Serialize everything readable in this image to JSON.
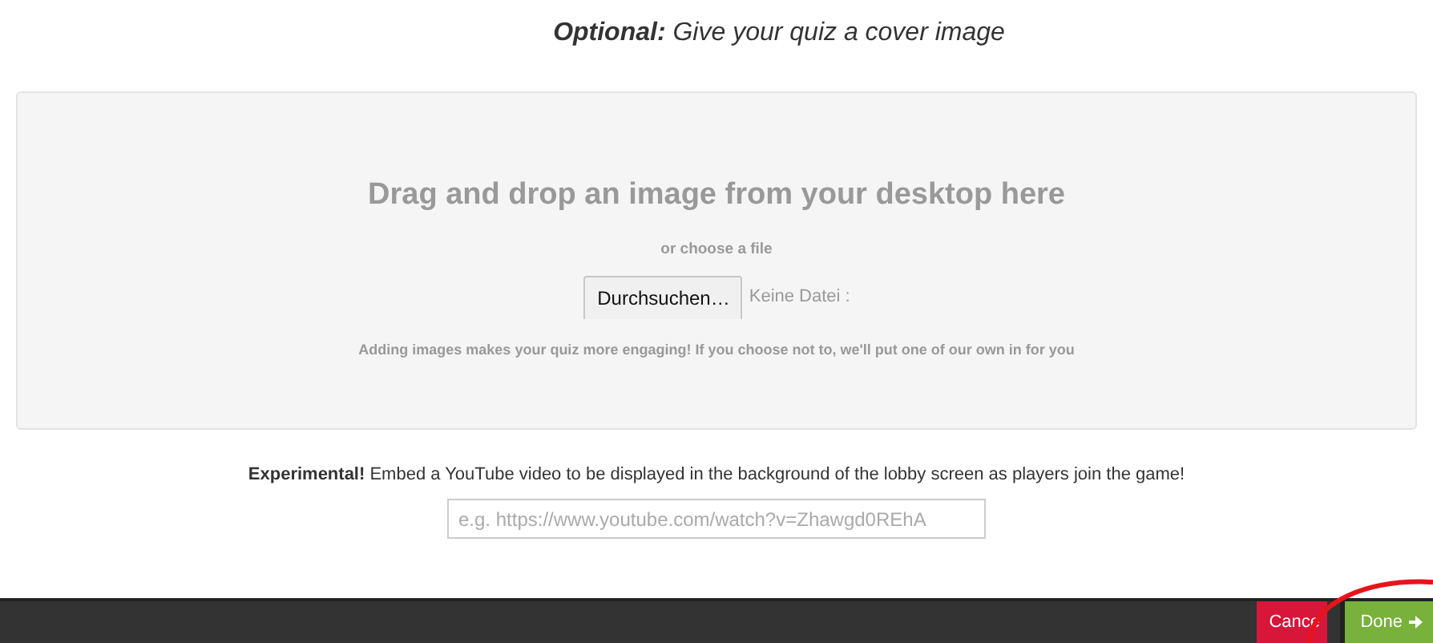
{
  "heading": "**Optional:** Give your quiz a cover image",
  "drop_zone": {
    "title": "Drag and drop an image from your desktop here",
    "subtitle": "or choose a file",
    "browse_button": "Durchsuchen…",
    "file_status": "Keine Datei :",
    "hint": "Adding images makes your quiz more engaging! If you choose not to, we'll put one of our own in for you"
  },
  "video": {
    "text": "**Experimental!** Embed a YouTube video to be displayed in the background of the lobby screen as players join the game!",
    "placeholder": "e.g. https://www.youtube.com/watch?v=Zhawgd0REhA"
  },
  "footer": {
    "buttons": [
      {
        "kind": "cancel",
        "label": "Cance"
      },
      {
        "kind": "done",
        "label": "Done"
      }
    ]
  }
}
